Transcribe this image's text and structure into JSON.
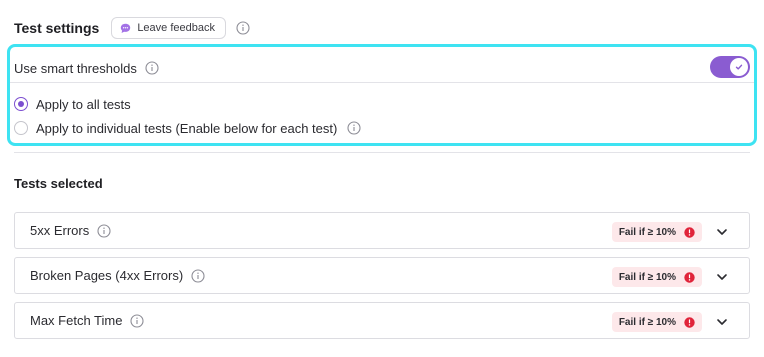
{
  "header": {
    "title": "Test settings",
    "feedback_label": "Leave feedback"
  },
  "smart_thresholds": {
    "label": "Use smart thresholds",
    "enabled": true,
    "options": [
      {
        "label": "Apply to all tests",
        "selected": true
      },
      {
        "label": "Apply to individual tests (Enable below for each test)",
        "selected": false
      }
    ]
  },
  "tests_section": {
    "title": "Tests selected",
    "tests": [
      {
        "name": "5xx Errors",
        "badge": "Fail if ≥ 10%"
      },
      {
        "name": "Broken Pages (4xx Errors)",
        "badge": "Fail if ≥ 10%"
      },
      {
        "name": "Max Fetch Time",
        "badge": "Fail if ≥ 10%"
      }
    ]
  },
  "colors": {
    "accent": "#8a5cd1",
    "highlight_border": "#3ee3f2",
    "badge_bg": "#fde8ea",
    "alert": "#e0243a"
  }
}
